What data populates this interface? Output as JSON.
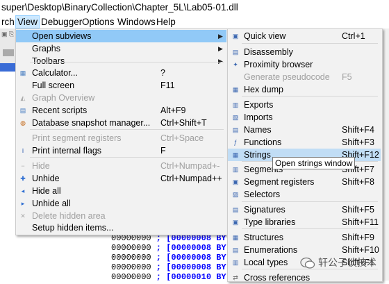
{
  "window": {
    "title": "super\\Desktop\\BinaryCollection\\Chapter_5L\\Lab05-01.dll"
  },
  "menubar": [
    {
      "label": "rch"
    },
    {
      "label": "View",
      "active": true
    },
    {
      "label": "Debugger"
    },
    {
      "label": "Options"
    },
    {
      "label": "Windows"
    },
    {
      "label": "Help"
    }
  ],
  "view_menu": {
    "items": [
      {
        "label": "Open subviews",
        "shortcut": "",
        "icon": "",
        "submenu": true,
        "highlighted": true
      },
      {
        "label": "Graphs",
        "shortcut": "",
        "icon": "",
        "submenu": true
      },
      {
        "label": "Toolbars",
        "shortcut": "",
        "icon": "",
        "submenu": true
      },
      {
        "label": "Calculator...",
        "shortcut": "?",
        "icon": "calculator-icon"
      },
      {
        "label": "Full screen",
        "shortcut": "F11",
        "icon": ""
      },
      {
        "label": "Graph Overview",
        "shortcut": "",
        "icon": "graph-overview-icon",
        "disabled": true
      },
      {
        "label": "Recent scripts",
        "shortcut": "Alt+F9",
        "icon": "scripts-icon"
      },
      {
        "label": "Database snapshot manager...",
        "shortcut": "Ctrl+Shift+T",
        "icon": "snapshot-icon"
      },
      {
        "label": "Print segment registers",
        "shortcut": "Ctrl+Space",
        "icon": "",
        "disabled": true
      },
      {
        "label": "Print internal flags",
        "shortcut": "F",
        "icon": "info-icon"
      },
      {
        "label": "Hide",
        "shortcut": "Ctrl+Numpad+-",
        "icon": "minus-icon",
        "disabled": true
      },
      {
        "label": "Unhide",
        "shortcut": "Ctrl+Numpad++",
        "icon": "plus-icon"
      },
      {
        "label": "Hide all",
        "shortcut": "",
        "icon": "hide-all-icon"
      },
      {
        "label": "Unhide all",
        "shortcut": "",
        "icon": "unhide-all-icon"
      },
      {
        "label": "Delete hidden area",
        "shortcut": "",
        "icon": "delete-icon",
        "disabled": true
      },
      {
        "label": "Setup hidden items...",
        "shortcut": "",
        "icon": ""
      }
    ]
  },
  "subviews_menu": {
    "items": [
      {
        "label": "Quick view",
        "shortcut": "Ctrl+1",
        "icon": "quick-view-icon"
      },
      {
        "label": "Disassembly",
        "shortcut": "",
        "icon": "disassembly-icon"
      },
      {
        "label": "Proximity browser",
        "shortcut": "",
        "icon": "proximity-icon"
      },
      {
        "label": "Generate pseudocode",
        "shortcut": "F5",
        "icon": "",
        "disabled": true
      },
      {
        "label": "Hex dump",
        "shortcut": "",
        "icon": "hex-icon"
      },
      {
        "label": "Exports",
        "shortcut": "",
        "icon": "exports-icon"
      },
      {
        "label": "Imports",
        "shortcut": "",
        "icon": "imports-icon"
      },
      {
        "label": "Names",
        "shortcut": "Shift+F4",
        "icon": "names-icon"
      },
      {
        "label": "Functions",
        "shortcut": "Shift+F3",
        "icon": "functions-icon"
      },
      {
        "label": "Strings",
        "shortcut": "Shift+F12",
        "icon": "strings-icon",
        "highlighted": true
      },
      {
        "label": "Segments",
        "shortcut": "Shift+F7",
        "icon": "segments-icon"
      },
      {
        "label": "Segment registers",
        "shortcut": "Shift+F8",
        "icon": "segment-registers-icon"
      },
      {
        "label": "Selectors",
        "shortcut": "",
        "icon": "selectors-icon"
      },
      {
        "label": "Signatures",
        "shortcut": "Shift+F5",
        "icon": "signatures-icon"
      },
      {
        "label": "Type libraries",
        "shortcut": "Shift+F11",
        "icon": "type-libraries-icon"
      },
      {
        "label": "Structures",
        "shortcut": "Shift+F9",
        "icon": "structures-icon"
      },
      {
        "label": "Enumerations",
        "shortcut": "Shift+F10",
        "icon": "enumerations-icon"
      },
      {
        "label": "Local types",
        "shortcut": "Shift+F1",
        "icon": "local-types-icon"
      },
      {
        "label": "Cross references",
        "shortcut": "",
        "icon": "xref-icon"
      }
    ]
  },
  "tooltip": {
    "text": "Open strings window"
  },
  "listing": [
    {
      "addr": "00000000",
      "text": " ; [00000008 BY"
    },
    {
      "addr": "00000000",
      "text": " ; [00000008 BY"
    },
    {
      "addr": "00000000",
      "text": " ; [00000008 BY"
    },
    {
      "addr": "00000000",
      "text": " ; [00000008 BY"
    },
    {
      "addr": "00000000",
      "text": " ; [00000010 BY"
    }
  ],
  "watermark": {
    "text": "轩公子谈技术"
  }
}
